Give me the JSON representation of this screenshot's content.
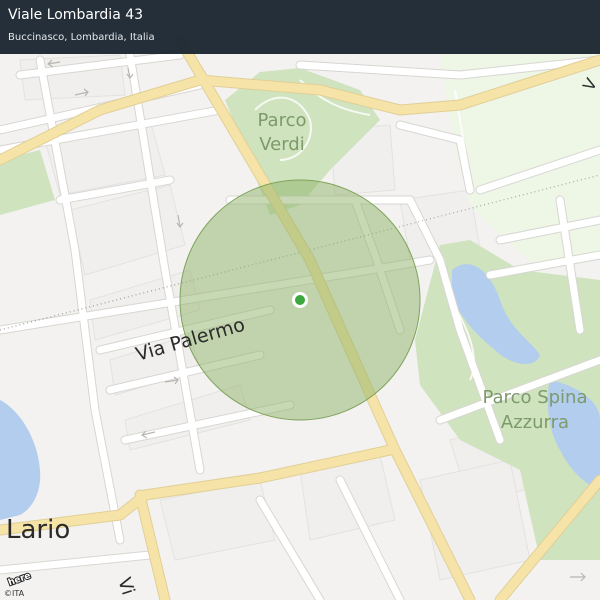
{
  "header": {
    "title": "Viale Lombardia 43",
    "subtitle": "Buccinasco, Lombardia, Italia"
  },
  "map": {
    "labels": {
      "park_verdi_line1": "Parco",
      "park_verdi_line2": "Verdi",
      "park_spina_line1": "Parco Spina",
      "park_spina_line2": "Azzurra",
      "street_palermo": "Via  Palermo",
      "street_lario": "Lario",
      "street_vi": "Vi",
      "street_v": "V"
    },
    "icons": {
      "location_marker": "location-pin-icon",
      "logo": "here-logo"
    },
    "colors": {
      "header_bg": "#1b2631",
      "park": "#cfe3bf",
      "water": "#b3cdee",
      "accuracy_circle": "#8fb46a",
      "marker": "#3aa83a",
      "major_road": "#f6e3a8",
      "road": "#ffffff"
    }
  },
  "footer": {
    "attribution": "©ITA",
    "logo_text": "here"
  }
}
